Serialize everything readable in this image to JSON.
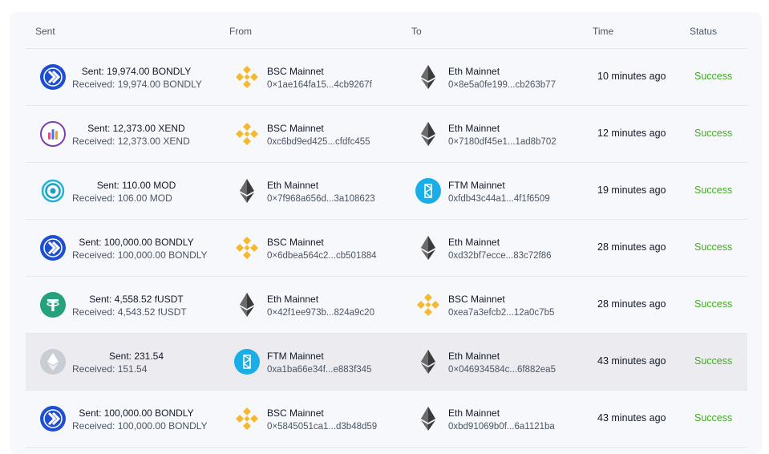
{
  "headers": {
    "sent": "Sent",
    "from": "From",
    "to": "To",
    "time": "Time",
    "status": "Status"
  },
  "colors": {
    "success": "#3fae1c",
    "bondly": "#1f4fd1",
    "bsc": "#f3ba2f",
    "eth": "#2b2b2b",
    "ftm": "#1aaee8",
    "tether": "#26a17b"
  },
  "rows": [
    {
      "token_icon": "bondly-icon",
      "sent": "Sent: 19,974.00 BONDLY",
      "received": "Received: 19,974.00 BONDLY",
      "from": {
        "icon": "bsc-icon",
        "name": "BSC Mainnet",
        "addr": "0×1ae164fa15...4cb9267f"
      },
      "to": {
        "icon": "eth-icon",
        "name": "Eth Mainnet",
        "addr": "0×8e5a0fe199...cb263b77"
      },
      "time": "10 minutes ago",
      "status": "Success"
    },
    {
      "token_icon": "xend-icon",
      "sent": "Sent: 12,373.00 XEND",
      "received": "Received: 12,373.00 XEND",
      "from": {
        "icon": "bsc-icon",
        "name": "BSC Mainnet",
        "addr": "0xc6bd9ed425...cfdfc455"
      },
      "to": {
        "icon": "eth-icon",
        "name": "Eth Mainnet",
        "addr": "0×7180df45e1...1ad8b702"
      },
      "time": "12 minutes ago",
      "status": "Success"
    },
    {
      "token_icon": "mod-icon",
      "sent": "Sent: 110.00 MOD",
      "received": "Received: 106.00 MOD",
      "from": {
        "icon": "eth-icon",
        "name": "Eth Mainnet",
        "addr": "0×7f968a656d...3a108623"
      },
      "to": {
        "icon": "ftm-icon",
        "name": "FTM Mainnet",
        "addr": "0xfdb43c44a1...4f1f6509"
      },
      "time": "19 minutes ago",
      "status": "Success"
    },
    {
      "token_icon": "bondly-icon",
      "sent": "Sent: 100,000.00 BONDLY",
      "received": "Received: 100,000.00 BONDLY",
      "from": {
        "icon": "bsc-icon",
        "name": "BSC Mainnet",
        "addr": "0×6dbea564c2...cb501884"
      },
      "to": {
        "icon": "eth-icon",
        "name": "Eth Mainnet",
        "addr": "0xd32bf7ecce...83c72f86"
      },
      "time": "28 minutes ago",
      "status": "Success"
    },
    {
      "token_icon": "tether-icon",
      "sent": "Sent: 4,558.52 fUSDT",
      "received": "Received: 4,543.52 fUSDT",
      "from": {
        "icon": "eth-icon",
        "name": "Eth Mainnet",
        "addr": "0×42f1ee973b...824a9c20"
      },
      "to": {
        "icon": "bsc-icon",
        "name": "BSC Mainnet",
        "addr": "0xea7a3efcb2...12a0c7b5"
      },
      "time": "28 minutes ago",
      "status": "Success"
    },
    {
      "token_icon": "eth-token-icon",
      "sent": "Sent: 231.54",
      "received": "Received: 151.54",
      "from": {
        "icon": "ftm-icon",
        "name": "FTM Mainnet",
        "addr": "0xa1ba66e34f...e883f345"
      },
      "to": {
        "icon": "eth-icon",
        "name": "Eth Mainnet",
        "addr": "0×046934584c...6f882ea5"
      },
      "time": "43 minutes ago",
      "status": "Success"
    },
    {
      "token_icon": "bondly-icon",
      "sent": "Sent: 100,000.00 BONDLY",
      "received": "Received: 100,000.00 BONDLY",
      "from": {
        "icon": "bsc-icon",
        "name": "BSC Mainnet",
        "addr": "0×5845051ca1...d3b48d59"
      },
      "to": {
        "icon": "eth-icon",
        "name": "Eth Mainnet",
        "addr": "0xbd91069b0f...6a1121ba"
      },
      "time": "43 minutes ago",
      "status": "Success"
    }
  ]
}
